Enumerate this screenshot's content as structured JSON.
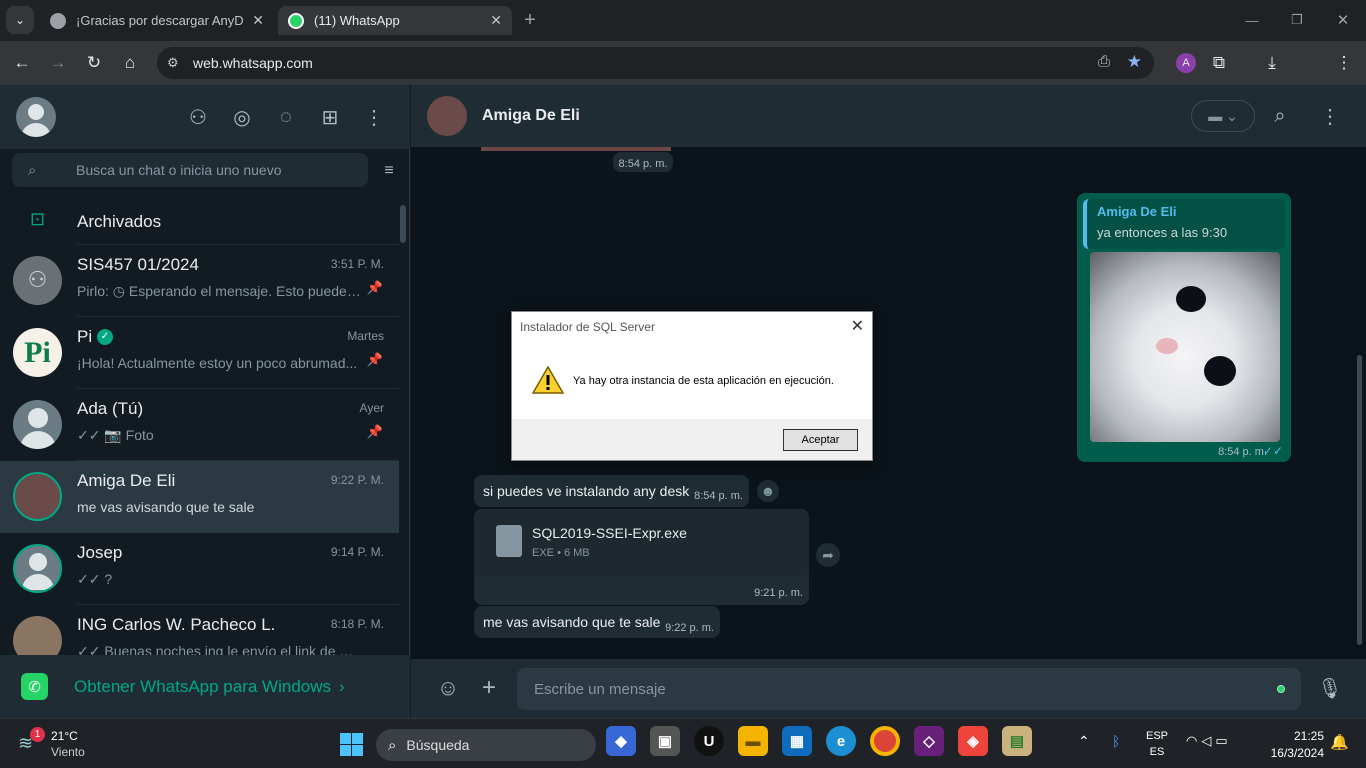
{
  "browser": {
    "tabs": [
      {
        "label": "¡Gracias por descargar AnyDesk",
        "close": "✕"
      },
      {
        "label": "(11) WhatsApp",
        "close": "✕",
        "badge": "11"
      }
    ],
    "new_tab": "+",
    "url": "web.whatsapp.com",
    "window_controls": {
      "minimize": "—",
      "restore": "❐",
      "close": "✕"
    }
  },
  "sidebar": {
    "search_placeholder": "Busca un chat o inicia uno nuevo",
    "archived_label": "Archivados",
    "chats": [
      {
        "name": "SIS457 01/2024",
        "time": "3:51 P. M.",
        "message": "Pirlo: ◷ Esperando el mensaje. Esto puede d...",
        "pinned": true
      },
      {
        "name": "Pi",
        "time": "Martes",
        "message": "¡Hola! Actualmente estoy un poco abrumad...",
        "pinned": true,
        "verified": true
      },
      {
        "name": "Ada (Tú)",
        "time": "Ayer",
        "message": "✓✓ 📷 Foto",
        "pinned": true
      },
      {
        "name": "Amiga De Eli",
        "time": "9:22 P. M.",
        "message": "me vas avisando que te sale",
        "selected": true
      },
      {
        "name": "Josep",
        "time": "9:14 P. M.",
        "message": "✓✓ ?"
      },
      {
        "name": "ING Carlos W. Pacheco L.",
        "time": "8:18 P. M.",
        "message": "✓✓ Buenas noches ing le envío el link de mi rep..."
      }
    ],
    "promo": "Obtener WhatsApp para Windows"
  },
  "conversation": {
    "contact_name": "Amiga De Eli",
    "top_time": "8:54 p. m.",
    "quoted": {
      "author": "Amiga De Eli",
      "text": "ya entonces a las 9:30",
      "time": "8:54 p. m."
    },
    "messages": [
      {
        "text": "si puedes ve instalando any desk",
        "time": "8:54 p. m."
      },
      {
        "file_name": "SQL2019-SSEI-Expr.exe",
        "file_meta": "EXE • 6 MB",
        "time": "9:21 p. m."
      },
      {
        "text": "me vas avisando que te sale",
        "time": "9:22 p. m."
      }
    ],
    "composer_placeholder": "Escribe un mensaje"
  },
  "dialog": {
    "title": "Instalador de SQL Server",
    "message": "Ya hay otra instancia de esta aplicación en ejecución.",
    "button": "Aceptar"
  },
  "taskbar": {
    "weather_temp": "21°C",
    "weather_desc": "Viento",
    "weather_badge": "1",
    "search": "Búsqueda",
    "lang1": "ESP",
    "lang2": "ES",
    "time": "21:25",
    "date": "16/3/2024"
  },
  "colors": {
    "accent": "#00a884",
    "outgoing": "#005c4b",
    "incoming": "#202c33",
    "background": "#0b141a"
  }
}
